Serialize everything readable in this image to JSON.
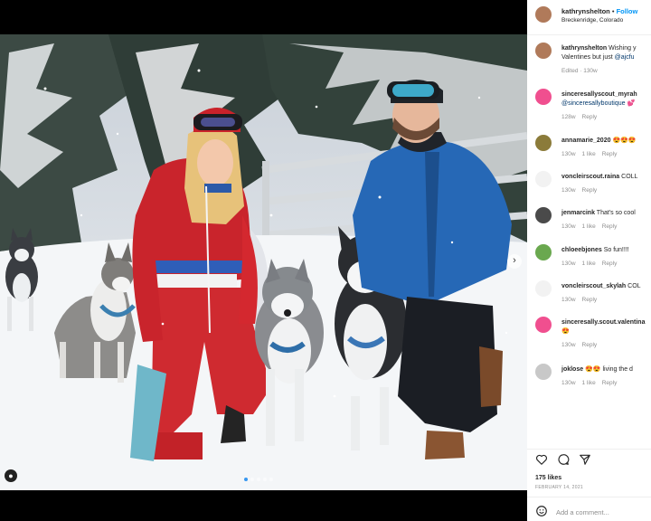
{
  "post": {
    "username": "kathrynshelton",
    "separator": "•",
    "follow_label": "Follow",
    "location": "Breckenridge, Colorado",
    "likes": "175 likes",
    "date": "FEBRUARY 14, 2021",
    "add_comment_placeholder": "Add a comment..."
  },
  "caption": {
    "username": "kathrynshelton",
    "text": "Wishing y",
    "text2_plain": "Valentines but just ",
    "text2_mention": "@ajcfu",
    "meta": "Edited · 130w"
  },
  "comments": [
    {
      "user": "sinceresallyscout_myrah",
      "text": "",
      "line2": "@sinceresallyboutique 💕",
      "time": "128w",
      "likes": "",
      "reply": "Reply"
    },
    {
      "user": "annamarie_2020",
      "text": "😍😍😍",
      "line2": "",
      "time": "130w",
      "likes": "1 like",
      "reply": "Reply"
    },
    {
      "user": "voncleirscout.raina",
      "text": "COLL",
      "line2": "",
      "time": "130w",
      "likes": "",
      "reply": "Reply"
    },
    {
      "user": "jenmarcink",
      "text": "That's so cool",
      "line2": "",
      "time": "130w",
      "likes": "1 like",
      "reply": "Reply"
    },
    {
      "user": "chloeebjones",
      "text": "So fun!!!!",
      "line2": "",
      "time": "130w",
      "likes": "1 like",
      "reply": "Reply"
    },
    {
      "user": "voncleirscout_skylah",
      "text": "COL",
      "line2": "",
      "time": "130w",
      "likes": "",
      "reply": "Reply"
    },
    {
      "user": "sinceresally.scout.valentina",
      "text": "",
      "line2": "😍",
      "time": "130w",
      "likes": "",
      "reply": "Reply"
    },
    {
      "user": "joklose",
      "text": "😍😍 living the d",
      "line2": "",
      "time": "130w",
      "likes": "1 like",
      "reply": "Reply"
    }
  ],
  "icons": [
    "heart-icon",
    "comment-icon",
    "share-icon",
    "emoji-icon",
    "user-tag-icon",
    "next-arrow-icon"
  ]
}
